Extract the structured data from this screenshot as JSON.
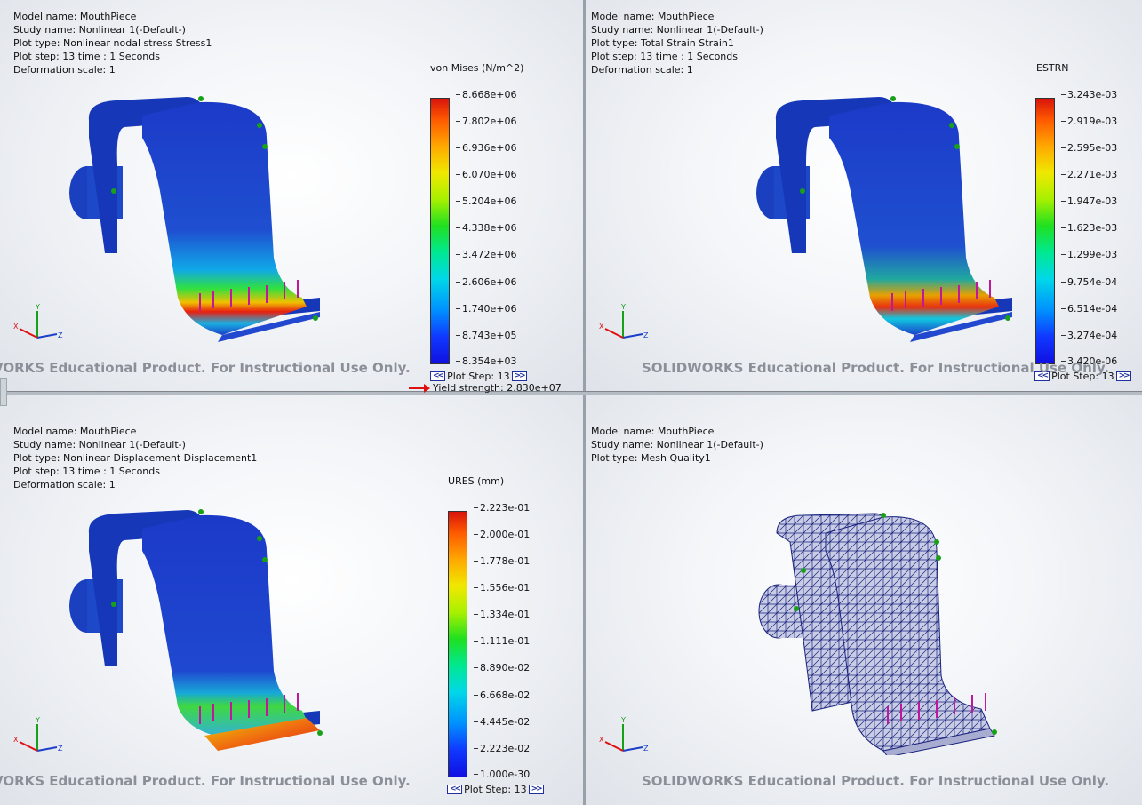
{
  "viewports": {
    "stress": {
      "info": [
        "Model name: MouthPiece",
        "Study name: Nonlinear 1(-Default-)",
        "Plot type: Nonlinear nodal stress Stress1",
        "Plot step: 13   time : 1 Seconds",
        "Deformation scale: 1"
      ],
      "legend_title": "von Mises (N/m^2)",
      "ticks": [
        "8.668e+06",
        "7.802e+06",
        "6.936e+06",
        "6.070e+06",
        "5.204e+06",
        "4.338e+06",
        "3.472e+06",
        "2.606e+06",
        "1.740e+06",
        "8.743e+05",
        "8.354e+03"
      ],
      "plot_step": "Plot Step: 13",
      "yield": "Yield strength: 2.830e+07",
      "watermark": "VORKS Educational Product. For Instructional Use Only."
    },
    "strain": {
      "info": [
        "Model name: MouthPiece",
        "Study name: Nonlinear 1(-Default-)",
        "Plot type: Total Strain Strain1",
        "Plot step: 13   time : 1 Seconds",
        "Deformation scale: 1"
      ],
      "legend_title": "ESTRN",
      "ticks": [
        "3.243e-03",
        "2.919e-03",
        "2.595e-03",
        "2.271e-03",
        "1.947e-03",
        "1.623e-03",
        "1.299e-03",
        "9.754e-04",
        "6.514e-04",
        "3.274e-04",
        "3.420e-06"
      ],
      "plot_step": "Plot Step: 13",
      "watermark": "SOLIDWORKS Educational Product. For Instructional Use Only."
    },
    "displacement": {
      "info": [
        "Model name: MouthPiece",
        "Study name: Nonlinear 1(-Default-)",
        "Plot type: Nonlinear Displacement Displacement1",
        "Plot step: 13   time : 1 Seconds",
        "Deformation scale: 1"
      ],
      "legend_title": "URES (mm)",
      "ticks": [
        "2.223e-01",
        "2.000e-01",
        "1.778e-01",
        "1.556e-01",
        "1.334e-01",
        "1.111e-01",
        "8.890e-02",
        "6.668e-02",
        "4.445e-02",
        "2.223e-02",
        "1.000e-30"
      ],
      "plot_step": "Plot Step: 13",
      "watermark": "VORKS Educational Product. For Instructional Use Only."
    },
    "mesh": {
      "info": [
        "Model name: MouthPiece",
        "Study name: Nonlinear 1(-Default-)",
        "Plot type: Mesh Quality1"
      ],
      "watermark": "SOLIDWORKS Educational Product. For Instructional Use Only."
    }
  },
  "triad": {
    "x": "X",
    "y": "Y",
    "z": "Z"
  },
  "colors": {
    "model_blue": "#1a3fc8",
    "hot_red": "#e81a0a",
    "mesh_fill": "#c8cce4",
    "mesh_line": "#1a237e",
    "load_arrow": "#c0189c",
    "fixture": "#18a018",
    "watermark": "#8b8f98"
  }
}
